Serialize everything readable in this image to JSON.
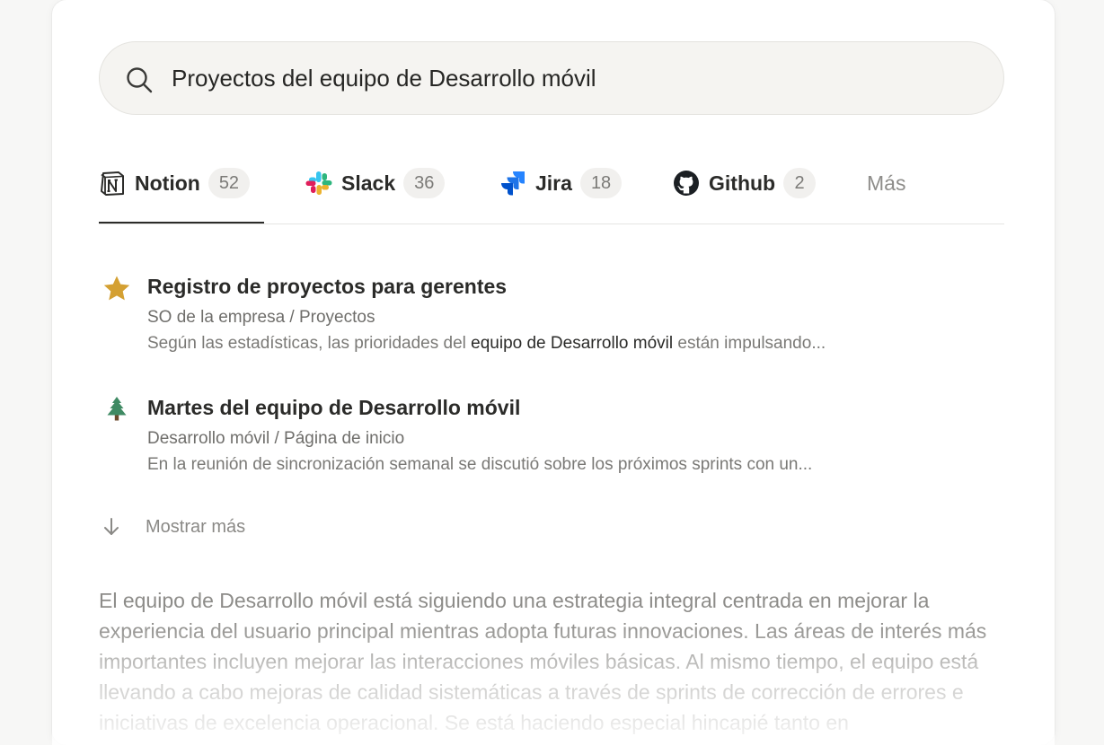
{
  "search": {
    "query": "Proyectos del equipo de Desarrollo móvil",
    "icon": "search-icon"
  },
  "tabs": [
    {
      "label": "Notion",
      "count": "52",
      "icon": "notion-icon",
      "active": true
    },
    {
      "label": "Slack",
      "count": "36",
      "icon": "slack-icon"
    },
    {
      "label": "Jira",
      "count": "18",
      "icon": "jira-icon"
    },
    {
      "label": "Github",
      "count": "2",
      "icon": "github-icon"
    },
    {
      "label": "Más",
      "icon": ""
    }
  ],
  "results": [
    {
      "icon": "star-icon",
      "title": "Registro de proyectos para gerentes",
      "path": "SO de la empresa / Proyectos",
      "snippet_before": "Según las estadísticas, las prioridades del ",
      "snippet_highlight": "equipo de Desarrollo móvil",
      "snippet_after": " están impulsando..."
    },
    {
      "icon": "tree-icon",
      "title": "Martes del equipo de Desarrollo móvil",
      "path": "Desarrollo móvil / Página de inicio",
      "snippet": "En la reunión de sincronización semanal se discutió sobre los próximos sprints con un..."
    }
  ],
  "show_more": {
    "label": "Mostrar más",
    "icon": "arrow-down-icon"
  },
  "summary": "El equipo de Desarrollo móvil está siguiendo una estrategia integral centrada en mejorar la experiencia del usuario principal mientras adopta futuras innovaciones. Las áreas de interés más importantes incluyen mejorar las interacciones móviles básicas. Al mismo tiempo, el equipo está llevando a cabo mejoras de calidad sistemáticas a través de sprints de corrección de errores e iniciativas de excelencia operacional. Se está haciendo especial hincapié tanto en",
  "colors": {
    "accent_text": "#2b2b29",
    "muted_text": "#8d8c89",
    "star": "#d4a032",
    "tree": "#3f8a63"
  }
}
